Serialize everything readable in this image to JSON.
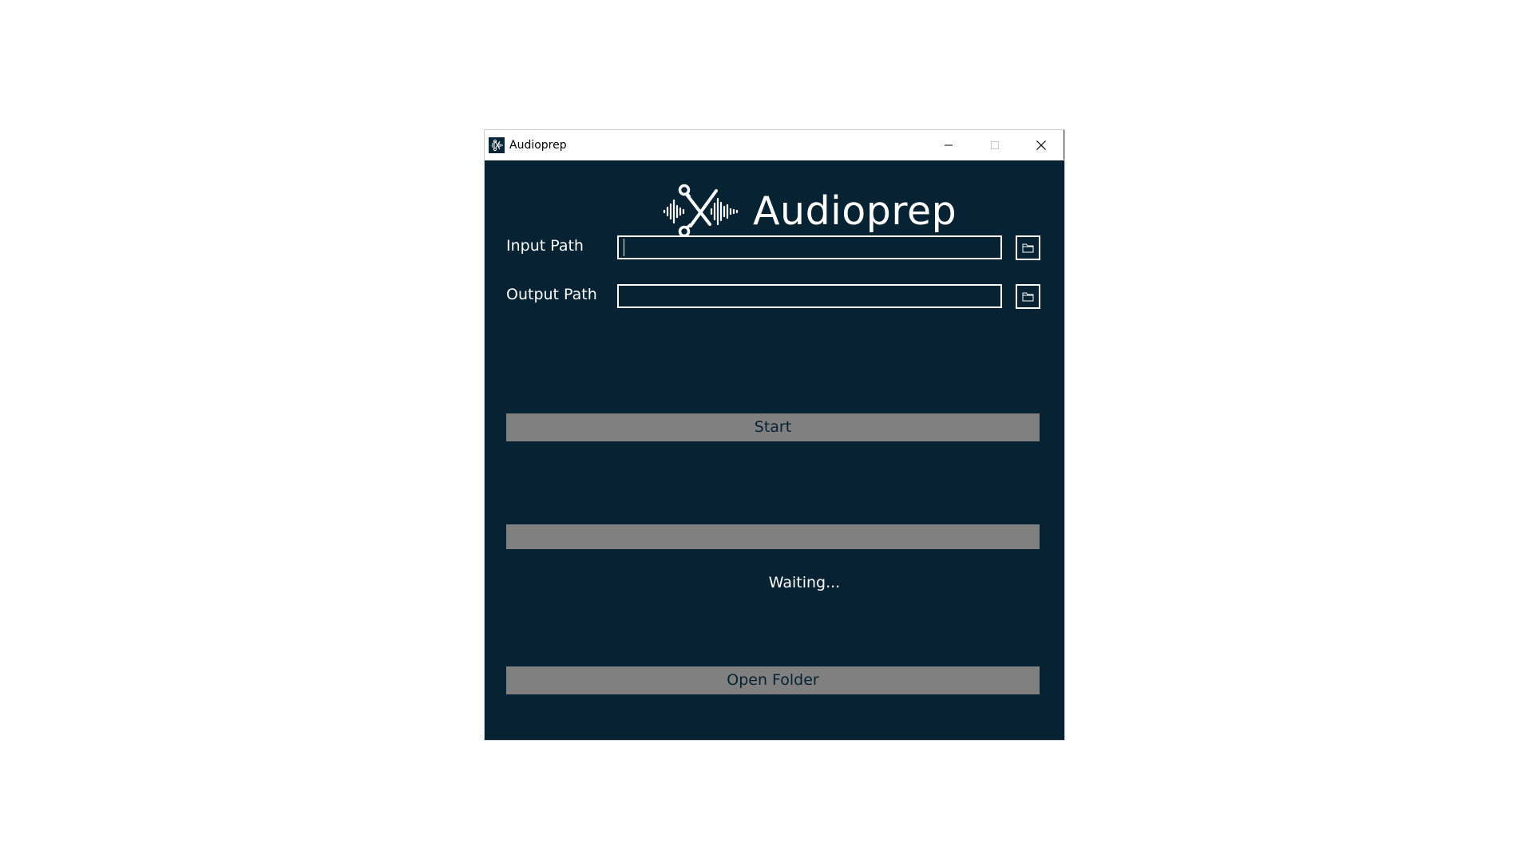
{
  "window": {
    "title": "Audioprep",
    "app_icon": "audioprep-scissors-waveform-icon"
  },
  "titlebar_buttons": {
    "minimize_icon": "minimize-icon",
    "maximize_icon": "maximize-icon",
    "close_icon": "close-icon"
  },
  "header": {
    "app_name": "Audioprep",
    "logo_icon": "scissors-waveform-logo"
  },
  "form": {
    "input_label": "Input Path",
    "input_value": "",
    "output_label": "Output Path",
    "output_value": "",
    "browse_icon": "folder-icon"
  },
  "actions": {
    "start_label": "Start",
    "open_folder_label": "Open Folder"
  },
  "progress": {
    "fraction": 0
  },
  "status": {
    "text": "Waiting..."
  },
  "colors": {
    "background": "#062233",
    "button_gray": "#808080",
    "text_white": "#ffffff"
  }
}
